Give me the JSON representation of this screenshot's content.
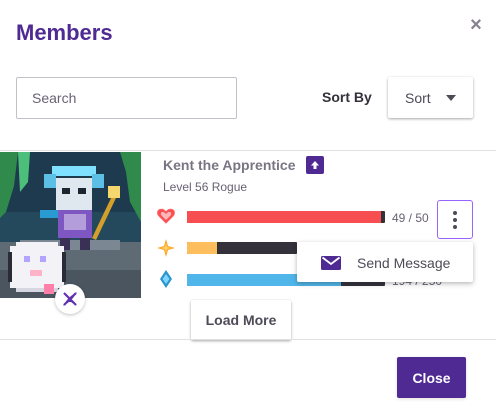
{
  "modal": {
    "title": "Members",
    "close_icon": "×",
    "close_label": "Close"
  },
  "toolbar": {
    "search_placeholder": "Search",
    "sort_by_label": "Sort By",
    "sort_value": "Sort"
  },
  "member": {
    "name": "Kent the Apprentice",
    "level": "Level 56 Rogue",
    "health": {
      "current": 49,
      "max": 50,
      "text": "49 / 50",
      "color": "#f74e52"
    },
    "experience": {
      "fill": 0.15,
      "color": "#ffbe5d"
    },
    "mana": {
      "text": "194 / 250",
      "fill": 0.78,
      "color": "#50b5e9"
    }
  },
  "member_menu": {
    "send_message_label": "Send Message",
    "icon": "envelope-icon"
  },
  "load_more_label": "Load More",
  "colors": {
    "brand": "#4f2a93",
    "focus": "#9a62ff"
  }
}
